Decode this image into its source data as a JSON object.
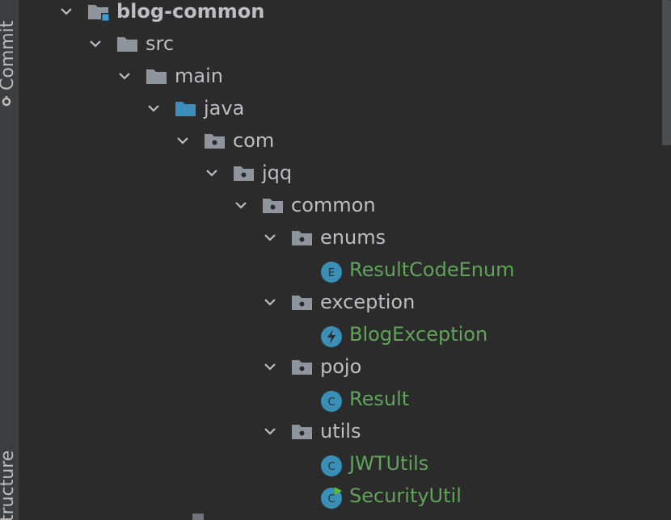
{
  "side_panel": {
    "commit_label": "Commit",
    "structure_label": "Structure"
  },
  "tree": {
    "items": [
      {
        "label": "blog-common",
        "icon": "module-folder-icon",
        "kind": "module",
        "expanded": true
      },
      {
        "label": "src",
        "icon": "folder-icon",
        "kind": "folder",
        "expanded": true
      },
      {
        "label": "main",
        "icon": "folder-icon",
        "kind": "folder",
        "expanded": true
      },
      {
        "label": "java",
        "icon": "source-root-folder-icon",
        "kind": "source-root",
        "expanded": true
      },
      {
        "label": "com",
        "icon": "package-icon",
        "kind": "package",
        "expanded": true
      },
      {
        "label": "jqq",
        "icon": "package-icon",
        "kind": "package",
        "expanded": true
      },
      {
        "label": "common",
        "icon": "package-icon",
        "kind": "package",
        "expanded": true
      },
      {
        "label": "enums",
        "icon": "package-icon",
        "kind": "package",
        "expanded": true
      },
      {
        "label": "ResultCodeEnum",
        "icon": "enum-icon",
        "kind": "file"
      },
      {
        "label": "exception",
        "icon": "package-icon",
        "kind": "package",
        "expanded": true
      },
      {
        "label": "BlogException",
        "icon": "exception-class-icon",
        "kind": "file"
      },
      {
        "label": "pojo",
        "icon": "package-icon",
        "kind": "package",
        "expanded": true
      },
      {
        "label": "Result",
        "icon": "class-icon",
        "kind": "file"
      },
      {
        "label": "utils",
        "icon": "package-icon",
        "kind": "package",
        "expanded": true
      },
      {
        "label": "JWTUtils",
        "icon": "class-icon",
        "kind": "file"
      },
      {
        "label": "SecurityUtil",
        "icon": "runnable-class-icon",
        "kind": "file"
      }
    ]
  },
  "colors": {
    "background": "#2b2b2b",
    "text": "#bcbec4",
    "source_file_text": "#62a35a",
    "folder": "#8f959c",
    "source_root_folder": "#3c8dbc",
    "class_badge": "#3a8fb7"
  }
}
